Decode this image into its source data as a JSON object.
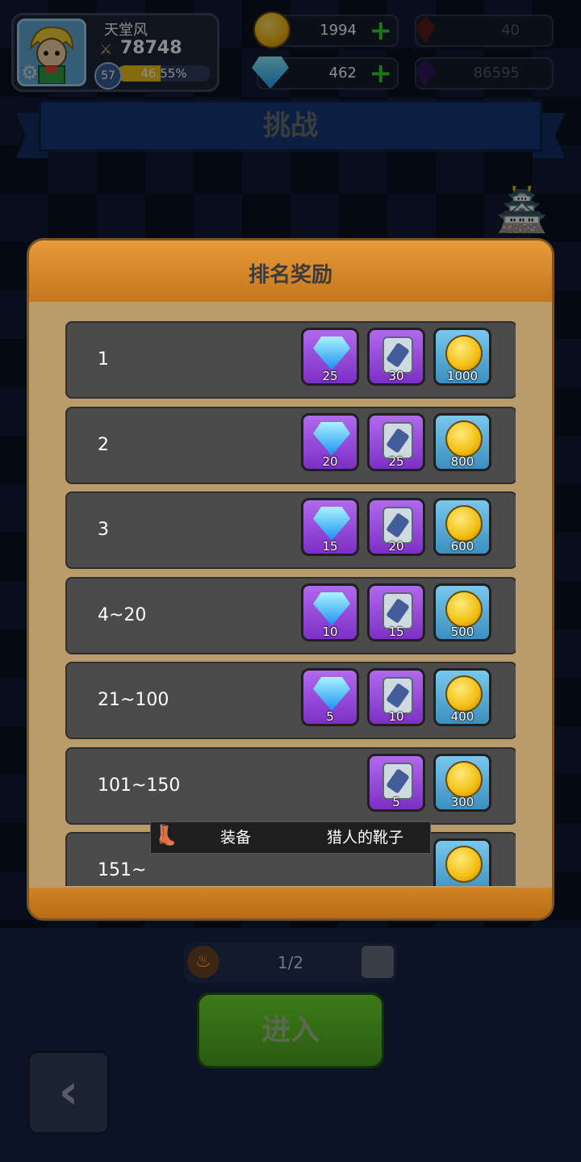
{
  "player": {
    "name": "天堂风",
    "power": "78748",
    "level": "57",
    "xp_percent": "46.55%",
    "xp_fraction": 0.4655
  },
  "currencies": {
    "gold": "1994",
    "diamond": "462",
    "red_crystal": "40",
    "purple_crystal": "86595"
  },
  "banner": {
    "title": "挑战"
  },
  "modal": {
    "title": "排名奖励",
    "rows": [
      {
        "rank": "1",
        "rewards": [
          {
            "type": "diamond",
            "qty": "25"
          },
          {
            "type": "scroll",
            "qty": "30"
          },
          {
            "type": "gold",
            "qty": "1000"
          }
        ]
      },
      {
        "rank": "2",
        "rewards": [
          {
            "type": "diamond",
            "qty": "20"
          },
          {
            "type": "scroll",
            "qty": "25"
          },
          {
            "type": "gold",
            "qty": "800"
          }
        ]
      },
      {
        "rank": "3",
        "rewards": [
          {
            "type": "diamond",
            "qty": "15"
          },
          {
            "type": "scroll",
            "qty": "20"
          },
          {
            "type": "gold",
            "qty": "600"
          }
        ]
      },
      {
        "rank": "4~20",
        "rewards": [
          {
            "type": "diamond",
            "qty": "10"
          },
          {
            "type": "scroll",
            "qty": "15"
          },
          {
            "type": "gold",
            "qty": "500"
          }
        ]
      },
      {
        "rank": "21~100",
        "rewards": [
          {
            "type": "diamond",
            "qty": "5"
          },
          {
            "type": "scroll",
            "qty": "10"
          },
          {
            "type": "gold",
            "qty": "400"
          }
        ]
      },
      {
        "rank": "101~150",
        "rewards": [
          {
            "type": "scroll",
            "qty": "5"
          },
          {
            "type": "gold",
            "qty": "300"
          }
        ]
      },
      {
        "rank": "151~",
        "rewards": [
          {
            "type": "gold",
            "qty": ""
          }
        ]
      }
    ]
  },
  "tooltip": {
    "category": "装备",
    "item_name": "猎人的靴子"
  },
  "ticket": {
    "count": "1/2"
  },
  "enter_button": {
    "label": "进入"
  },
  "colors": {
    "modal_header": "#e69b38",
    "modal_body": "#b99b6c",
    "row_bg": "#4b4b4b",
    "enter_button": "#3d7a1a",
    "xp_bar": "#f2c316"
  }
}
